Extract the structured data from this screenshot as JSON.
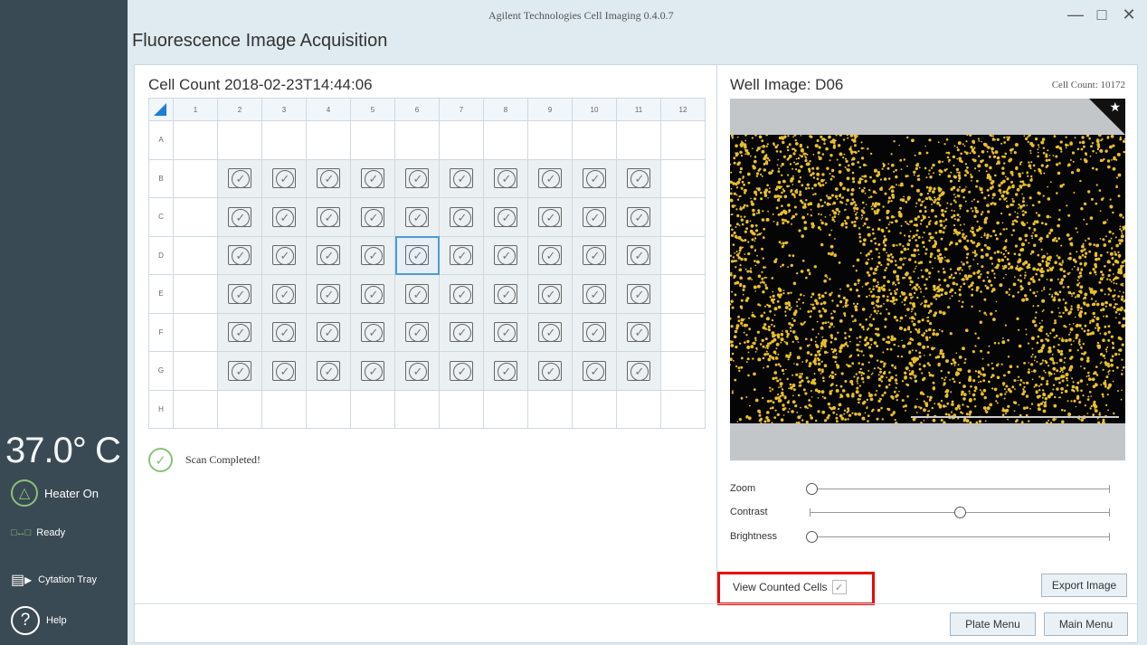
{
  "window": {
    "app_title": "Agilent Technologies Cell Imaging 0.4.0.7",
    "screen_title": "Fluorescence Image Acquisition",
    "controls": {
      "minimize": "—",
      "maximize": "□",
      "close": "✕"
    }
  },
  "sidebar": {
    "temperature": "37.0° C",
    "heater": {
      "icon": "heater-flame-icon",
      "label": "Heater On"
    },
    "ready": {
      "icon": "connection-icon",
      "label": "Ready"
    },
    "tray": {
      "icon": "tray-icon",
      "label": "Cytation Tray"
    },
    "help": {
      "icon": "help-icon",
      "label": "Help"
    }
  },
  "plate": {
    "title": "Cell Count 2018-02-23T14:44:06",
    "columns": [
      "1",
      "2",
      "3",
      "4",
      "5",
      "6",
      "7",
      "8",
      "9",
      "10",
      "11",
      "12"
    ],
    "rows": [
      "A",
      "B",
      "C",
      "D",
      "E",
      "F",
      "G",
      "H"
    ],
    "completed_rows": [
      "B",
      "C",
      "D",
      "E",
      "F",
      "G"
    ],
    "completed_columns": [
      "2",
      "3",
      "4",
      "5",
      "6",
      "7",
      "8",
      "9",
      "10",
      "11"
    ],
    "selected_well": "D6",
    "status": {
      "icon": "check-circle-icon",
      "text": "Scan Completed!"
    }
  },
  "well_view": {
    "title": "Well Image: D06",
    "cell_count": "Cell Count: 10172",
    "sliders": [
      {
        "label": "Zoom",
        "value": 0.0
      },
      {
        "label": "Contrast",
        "value": 0.5
      },
      {
        "label": "Brightness",
        "value": 0.0
      }
    ],
    "view_counted_cells": {
      "label": "View Counted Cells",
      "checked": true
    },
    "export_label": "Export Image"
  },
  "footer": {
    "plate_menu_label": "Plate Menu",
    "main_menu_label": "Main Menu"
  },
  "colors": {
    "accent": "#1c7fd6",
    "ok_green": "#8cc07a",
    "cell_yellow": "#e8c02a",
    "highlight_red": "#e8090a"
  }
}
